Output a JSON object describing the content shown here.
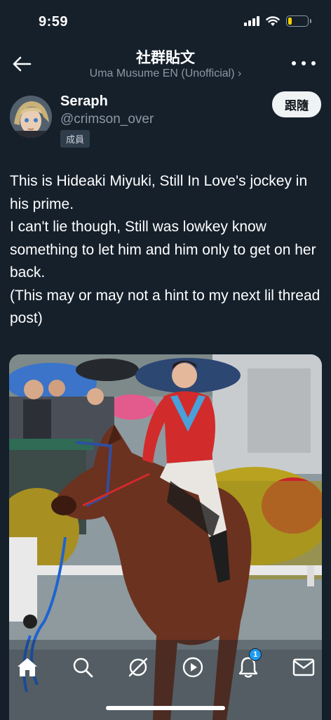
{
  "status_bar": {
    "time": "9:59",
    "battery_level": 0.18,
    "battery_color": "#f5d000",
    "signal_icon": "cellular-signal-icon",
    "wifi_icon": "wifi-icon"
  },
  "header": {
    "title": "社群貼文",
    "community": "Uma Musume EN (Unofficial) ›",
    "back_icon": "back-arrow-icon",
    "more_icon": "more-dots-icon"
  },
  "author": {
    "name": "Seraph",
    "handle": "@crimson_over",
    "role": "成員",
    "follow_label": "跟隨"
  },
  "post": {
    "lines": [
      "This is Hideaki Miyuki, Still In Love's jockey in his prime.",
      "I can't lie though, Still was lowkey know something to let him and him only to get on her back.",
      "(This may or may not a hint to my next lil thread post)"
    ]
  },
  "bottom_nav": {
    "items": [
      {
        "icon": "home-icon"
      },
      {
        "icon": "search-icon"
      },
      {
        "icon": "grok-icon"
      },
      {
        "icon": "video-play-icon"
      },
      {
        "icon": "notifications-bell-icon",
        "badge": "1"
      },
      {
        "icon": "messages-envelope-icon"
      }
    ]
  },
  "colors": {
    "background": "#15202b",
    "muted_text": "#8b98a5",
    "accent": "#1d9bf0"
  }
}
